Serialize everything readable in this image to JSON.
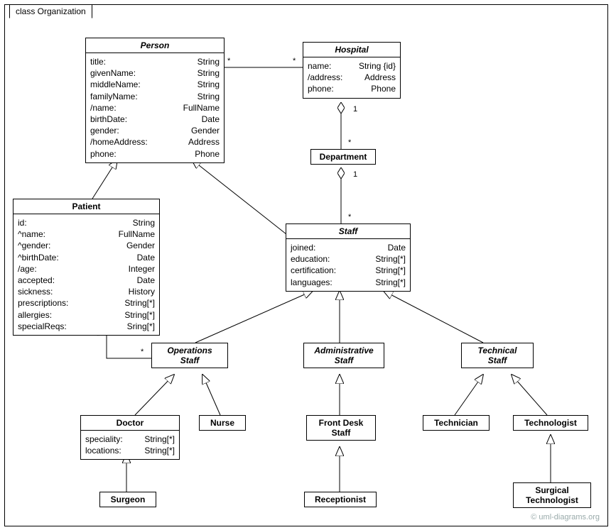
{
  "frameLabel": "class Organization",
  "watermark": "© uml-diagrams.org",
  "classes": {
    "person": {
      "title": "Person",
      "attrs": [
        [
          "title:",
          "String"
        ],
        [
          "givenName:",
          "String"
        ],
        [
          "middleName:",
          "String"
        ],
        [
          "familyName:",
          "String"
        ],
        [
          "/name:",
          "FullName"
        ],
        [
          "birthDate:",
          "Date"
        ],
        [
          "gender:",
          "Gender"
        ],
        [
          "/homeAddress:",
          "Address"
        ],
        [
          "phone:",
          "Phone"
        ]
      ]
    },
    "hospital": {
      "title": "Hospital",
      "attrs": [
        [
          "name:",
          "String {id}"
        ],
        [
          "/address:",
          "Address"
        ],
        [
          "phone:",
          "Phone"
        ]
      ]
    },
    "department": {
      "title": "Department"
    },
    "patient": {
      "title": "Patient",
      "attrs": [
        [
          "id:",
          "String"
        ],
        [
          "^name:",
          "FullName"
        ],
        [
          "^gender:",
          "Gender"
        ],
        [
          "^birthDate:",
          "Date"
        ],
        [
          "/age:",
          "Integer"
        ],
        [
          "accepted:",
          "Date"
        ],
        [
          "sickness:",
          "History"
        ],
        [
          "prescriptions:",
          "String[*]"
        ],
        [
          "allergies:",
          "String[*]"
        ],
        [
          "specialReqs:",
          "Sring[*]"
        ]
      ]
    },
    "staff": {
      "title": "Staff",
      "attrs": [
        [
          "joined:",
          "Date"
        ],
        [
          "education:",
          "String[*]"
        ],
        [
          "certification:",
          "String[*]"
        ],
        [
          "languages:",
          "String[*]"
        ]
      ]
    },
    "ops": {
      "title": "Operations\nStaff"
    },
    "admin": {
      "title": "Administrative\nStaff"
    },
    "tech": {
      "title": "Technical\nStaff"
    },
    "doctor": {
      "title": "Doctor",
      "attrs": [
        [
          "speciality:",
          "String[*]"
        ],
        [
          "locations:",
          "String[*]"
        ]
      ]
    },
    "nurse": {
      "title": "Nurse"
    },
    "frontDesk": {
      "title": "Front Desk\nStaff"
    },
    "technician": {
      "title": "Technician"
    },
    "technologist": {
      "title": "Technologist"
    },
    "surgeon": {
      "title": "Surgeon"
    },
    "receptionist": {
      "title": "Receptionist"
    },
    "surgTech": {
      "title": "Surgical\nTechnologist"
    }
  },
  "mult": {
    "m1": "*",
    "m2": "*",
    "m3": "1",
    "m4": "*",
    "m5": "1",
    "m6": "*",
    "m7": "*",
    "m8": "*"
  }
}
